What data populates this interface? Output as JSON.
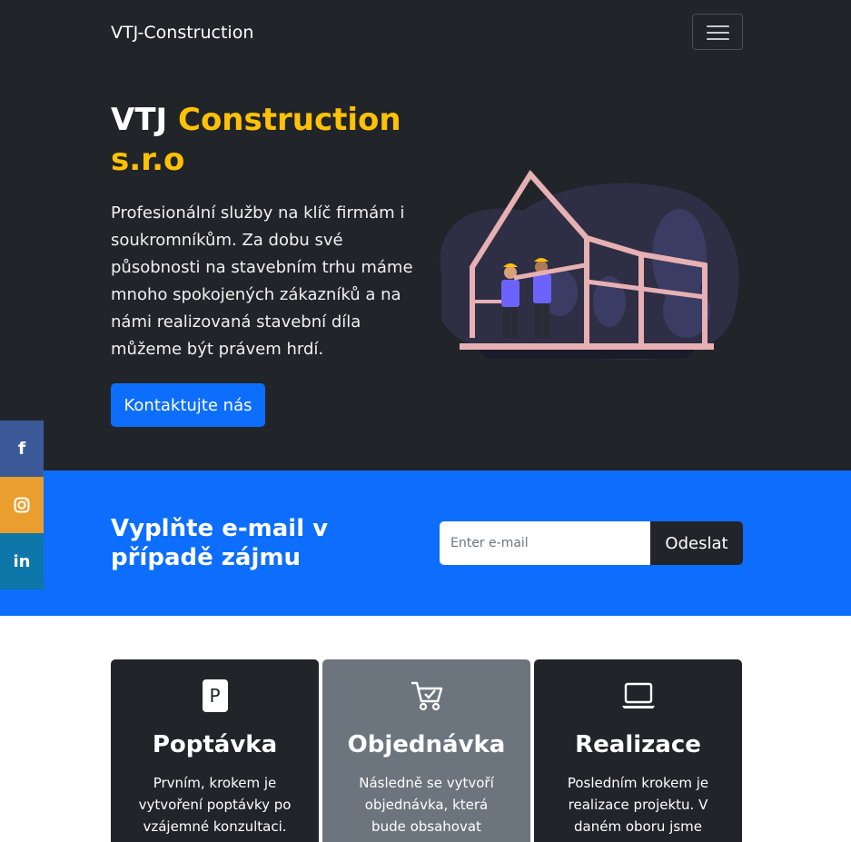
{
  "nav": {
    "brand": "VTJ-Construction"
  },
  "hero": {
    "title_main": "VTJ ",
    "title_accent": "Construction s.r.o",
    "description": "Profesionální služby na klíč firmám i soukromníkům. Za dobu své působnosti na stavebním trhu máme mnoho spokojených zákazníků a na námi realizovaná stavební díla můžeme být právem hrdí.",
    "cta_label": "Kontaktujte nás"
  },
  "social": [
    {
      "icon": "facebook-icon",
      "glyph": "f",
      "color": "#3b5998"
    },
    {
      "icon": "instagram-icon",
      "glyph": "",
      "color": "#e99e2d"
    },
    {
      "icon": "linkedin-icon",
      "glyph": "in",
      "color": "#0e76a8"
    }
  ],
  "newsletter": {
    "heading": "Vyplňte e-mail v případě zájmu",
    "placeholder": "Enter e-mail",
    "button_label": "Odeslat"
  },
  "steps": [
    {
      "title": "Poptávka",
      "icon": "parking-sign-icon",
      "glyph": "P",
      "text": "Prvním, krokem je vytvoření poptávky po vzájemné konzultaci."
    },
    {
      "title": "Objednávka",
      "icon": "cart-check-icon",
      "text": "Následně se vytvoří objednávka, která bude obsahovat"
    },
    {
      "title": "Realizace",
      "icon": "laptop-icon",
      "text": "Posledním krokem je realizace projektu. V daném oboru jsme"
    }
  ],
  "colors": {
    "dark": "#212529",
    "primary": "#0d6efd",
    "accent": "#ffc107",
    "secondary": "#6c757d"
  }
}
